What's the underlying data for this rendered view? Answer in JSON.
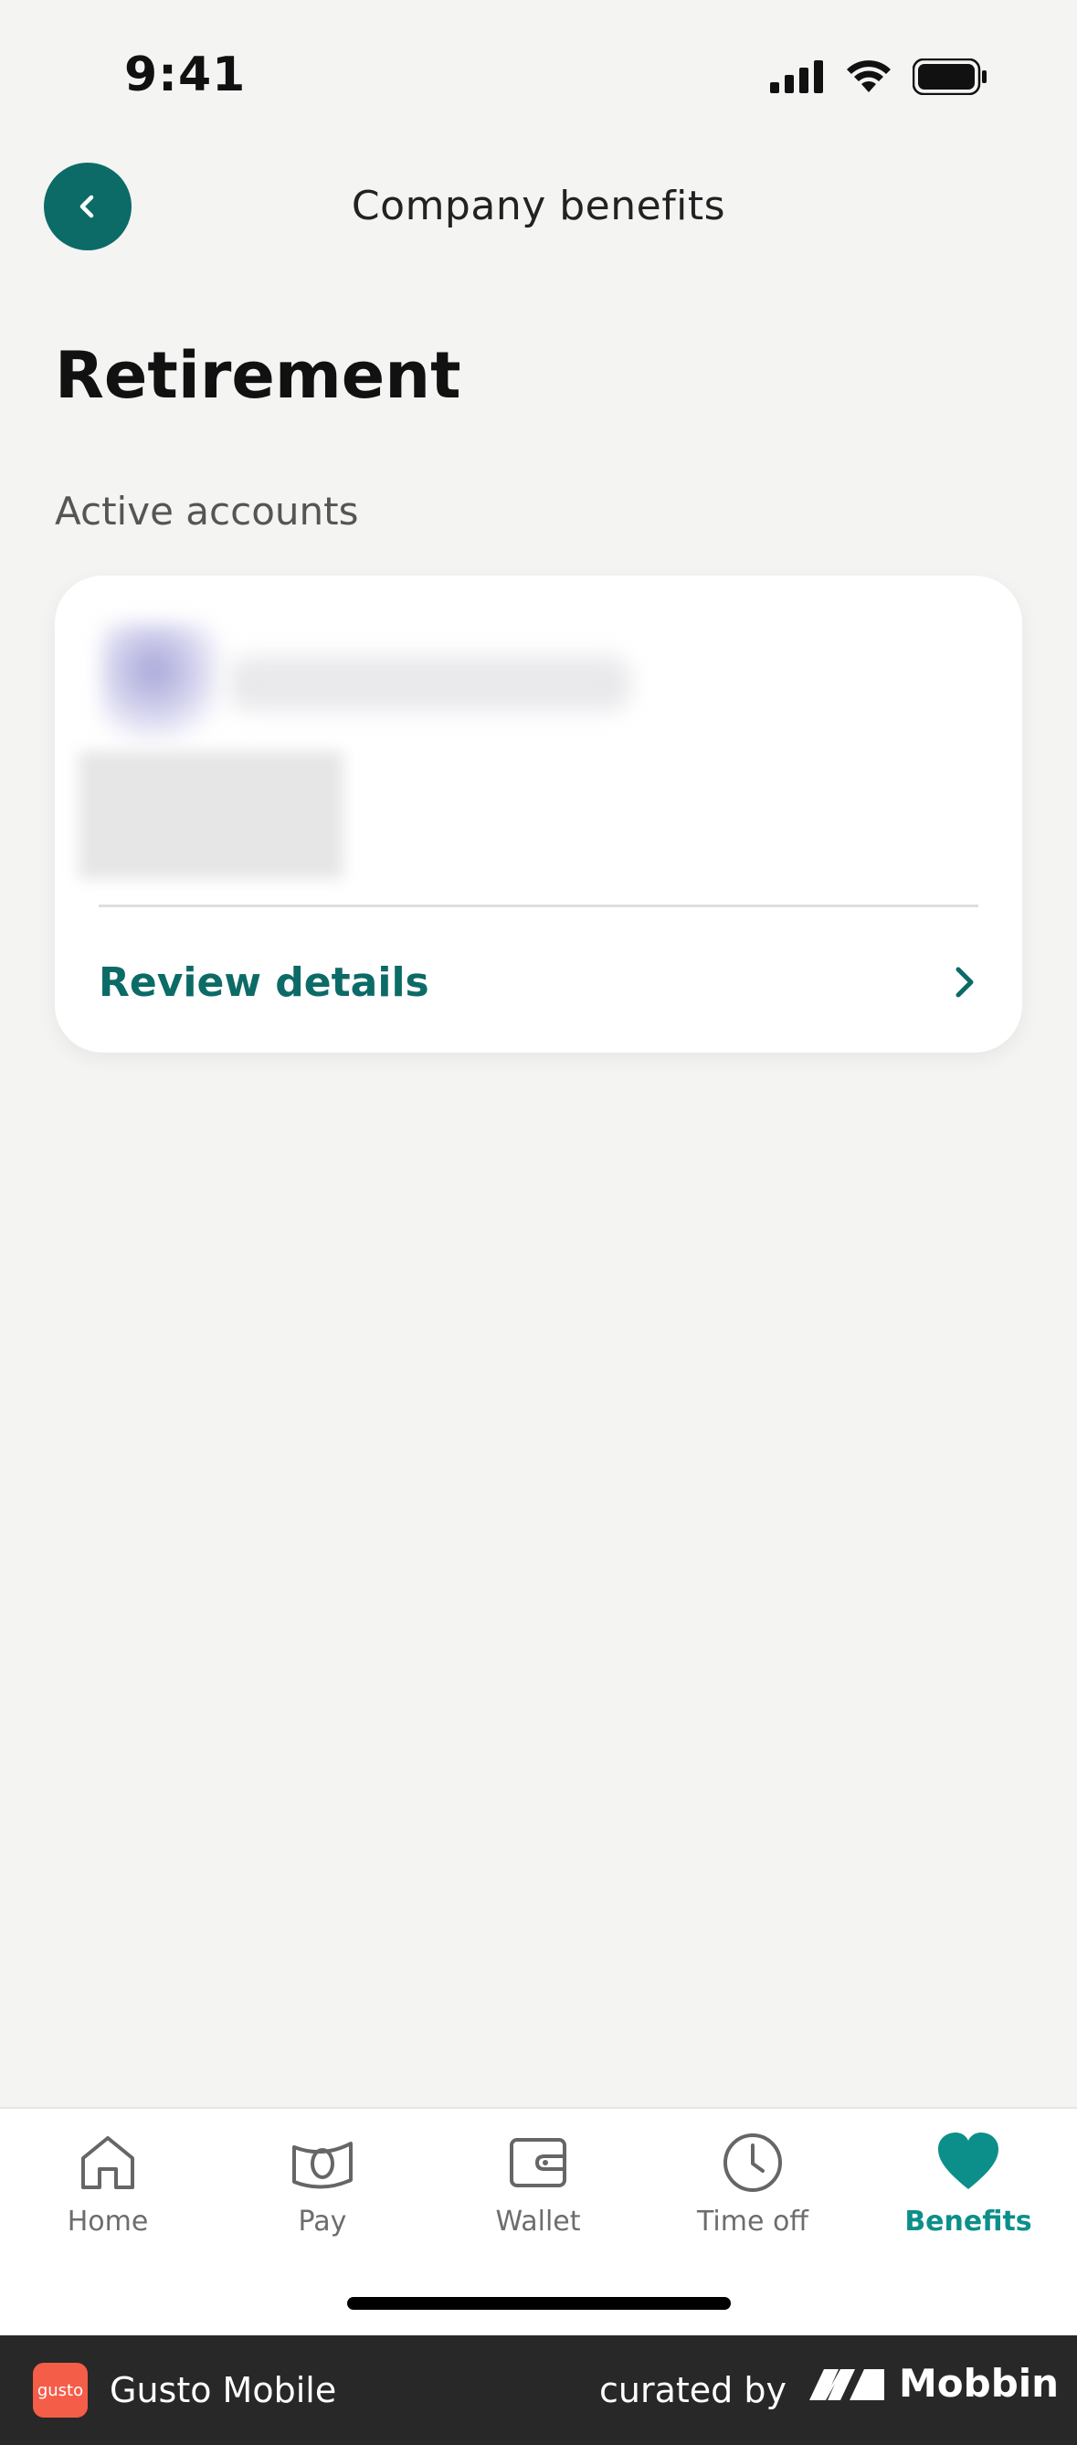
{
  "status_bar": {
    "time": "9:41"
  },
  "header": {
    "title": "Company benefits"
  },
  "page": {
    "title": "Retirement",
    "section_label": "Active accounts"
  },
  "account_card": {
    "action_label": "Review details"
  },
  "tab_bar": {
    "items": [
      {
        "label": "Home",
        "icon": "home-icon",
        "active": false
      },
      {
        "label": "Pay",
        "icon": "money-icon",
        "active": false
      },
      {
        "label": "Wallet",
        "icon": "wallet-icon",
        "active": false
      },
      {
        "label": "Time off",
        "icon": "clock-icon",
        "active": false
      },
      {
        "label": "Benefits",
        "icon": "heart-icon",
        "active": true
      }
    ]
  },
  "footer": {
    "logo_text": "gusto",
    "app_name": "Gusto Mobile",
    "curated_by": "curated by",
    "brand": "Mobbin"
  },
  "colors": {
    "accent": "#0c6b67",
    "active_tab": "#0c8f8a",
    "background": "#f4f4f3"
  }
}
